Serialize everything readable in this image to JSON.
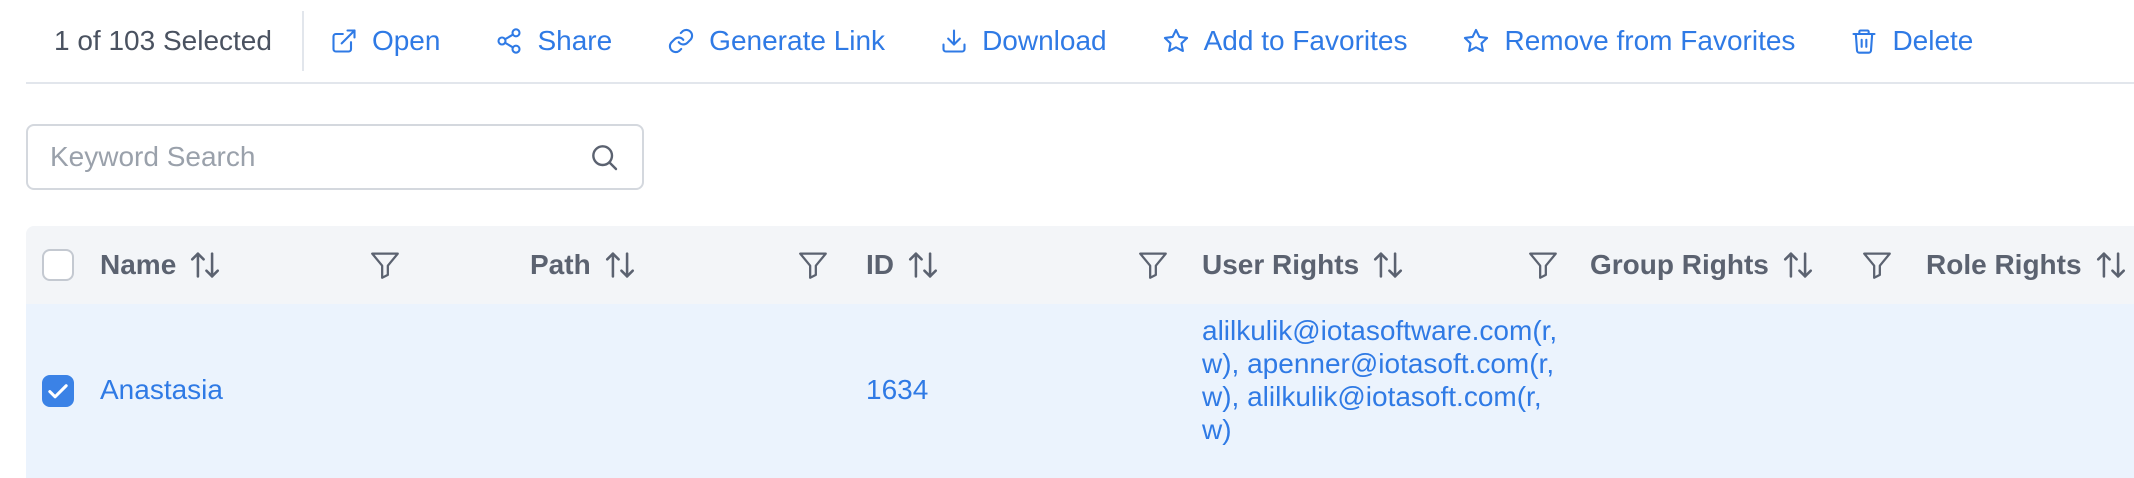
{
  "toolbar": {
    "selection_text": "1 of 103 Selected",
    "actions": [
      {
        "label": "Open",
        "icon": "external-link-icon"
      },
      {
        "label": "Share",
        "icon": "share-icon"
      },
      {
        "label": "Generate Link",
        "icon": "link-icon"
      },
      {
        "label": "Download",
        "icon": "download-icon"
      },
      {
        "label": "Add to Favorites",
        "icon": "star-icon"
      },
      {
        "label": "Remove from Favorites",
        "icon": "star-outline-icon"
      },
      {
        "label": "Delete",
        "icon": "trash-icon"
      }
    ]
  },
  "search": {
    "placeholder": "Keyword Search",
    "value": ""
  },
  "table": {
    "columns": [
      {
        "label": "Name",
        "sortable": true,
        "filterable": true
      },
      {
        "label": "Path",
        "sortable": true,
        "filterable": true
      },
      {
        "label": "ID",
        "sortable": true,
        "filterable": true
      },
      {
        "label": "User Rights",
        "sortable": true,
        "filterable": true
      },
      {
        "label": "Group Rights",
        "sortable": true,
        "filterable": true
      },
      {
        "label": "Role Rights",
        "sortable": true,
        "filterable": false
      }
    ],
    "rows": [
      {
        "selected": true,
        "name": "Anastasia",
        "path": "",
        "id": "1634",
        "user_rights": "alilkulik@iotasoftware.com(r, w), apenner@iotasoft.com(r, w), alilkulik@iotasoft.com(r, w)",
        "group_rights": "",
        "role_rights": ""
      }
    ]
  },
  "colors": {
    "accent": "#2f7ae5",
    "checkbox_checked": "#3b82e6",
    "header_bg": "#f3f5f8",
    "selected_row_bg": "#ebf3fd",
    "header_text": "#5b6270",
    "muted_text": "#4a5260"
  }
}
